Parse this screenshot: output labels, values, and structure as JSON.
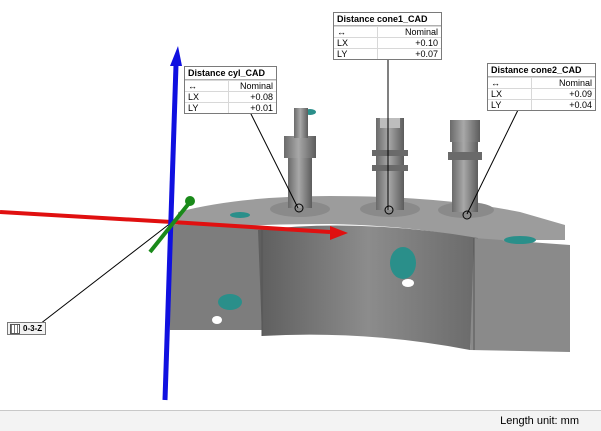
{
  "labels": {
    "cyl": {
      "title": "Distance cyl_CAD",
      "header": "Nominal",
      "rows": [
        {
          "name": "LX",
          "value": "+0.08"
        },
        {
          "name": "LY",
          "value": "+0.01"
        }
      ]
    },
    "cone1": {
      "title": "Distance cone1_CAD",
      "header": "Nominal",
      "rows": [
        {
          "name": "LX",
          "value": "+0.10"
        },
        {
          "name": "LY",
          "value": "+0.07"
        }
      ]
    },
    "cone2": {
      "title": "Distance cone2_CAD",
      "header": "Nominal",
      "rows": [
        {
          "name": "LX",
          "value": "+0.09"
        },
        {
          "name": "LY",
          "value": "+0.04"
        }
      ]
    }
  },
  "coordinate_tag": "0-3-Z",
  "status": {
    "length_unit": "Length unit: mm"
  },
  "colors": {
    "x_axis": "#e01010",
    "y_axis": "#1010e0",
    "z_axis": "#1a8a1a",
    "part": "#8a8a8a",
    "deviation": "#2a8f8a"
  }
}
